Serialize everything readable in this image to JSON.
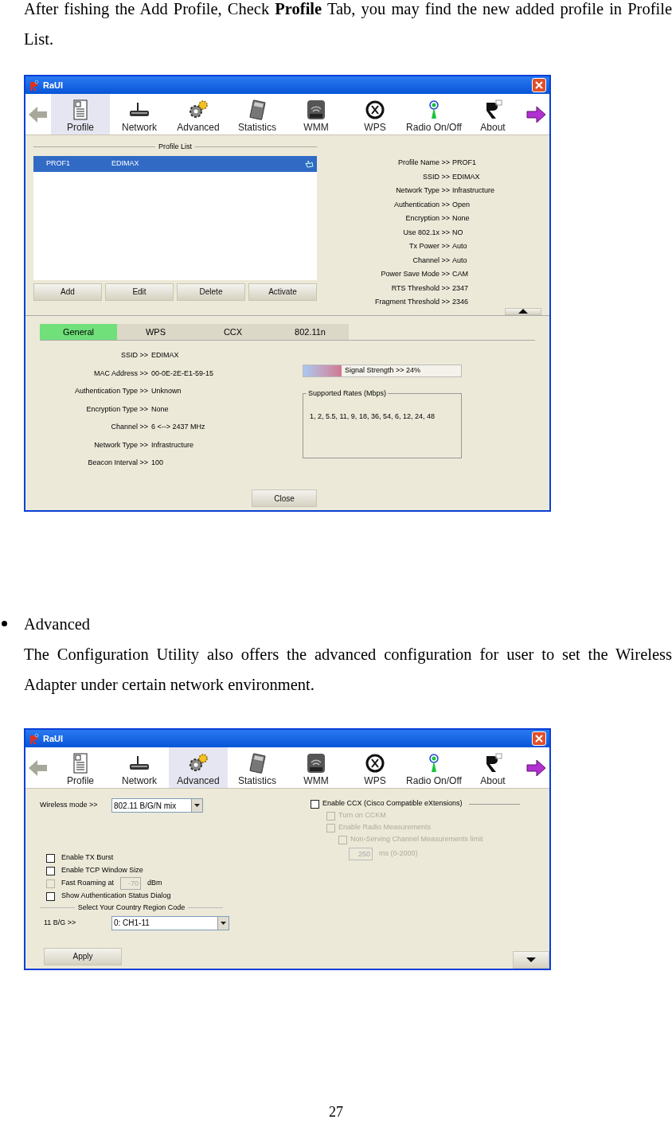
{
  "intro": "After fishing the Add Profile, Check **Profile** Tab, you may find the new added profile in Profile List.",
  "window_profile": {
    "title": "RaUI",
    "toolbar": [
      {
        "label": "Profile",
        "kind": "profile",
        "selected": true
      },
      {
        "label": "Network",
        "kind": "network",
        "selected": false
      },
      {
        "label": "Advanced",
        "kind": "advanced",
        "selected": false
      },
      {
        "label": "Statistics",
        "kind": "statistics",
        "selected": false
      },
      {
        "label": "WMM",
        "kind": "wmm",
        "selected": false
      },
      {
        "label": "WPS",
        "kind": "wps",
        "selected": false
      },
      {
        "label": "Radio On/Off",
        "kind": "radio",
        "selected": false
      },
      {
        "label": "About",
        "kind": "about",
        "selected": false
      }
    ],
    "profile_list": {
      "legend": "Profile List",
      "rows": [
        {
          "name": "PROF1",
          "ssid": "EDIMAX",
          "selected": true
        }
      ],
      "buttons": [
        "Add",
        "Edit",
        "Delete",
        "Activate"
      ]
    },
    "details": [
      {
        "label": "Profile Name >>",
        "value": "PROF1"
      },
      {
        "label": "SSID >>",
        "value": "EDIMAX"
      },
      {
        "label": "Network Type >>",
        "value": "Infrastructure"
      },
      {
        "label": "Authentication >>",
        "value": "Open"
      },
      {
        "label": "Encryption >>",
        "value": "None"
      },
      {
        "label": "Use 802.1x >>",
        "value": "NO"
      },
      {
        "label": "Tx Power >>",
        "value": "Auto"
      },
      {
        "label": "Channel >>",
        "value": "Auto"
      },
      {
        "label": "Power Save Mode >>",
        "value": "CAM"
      },
      {
        "label": "RTS Threshold >>",
        "value": "2347"
      },
      {
        "label": "Fragment Threshold >>",
        "value": "2346"
      }
    ],
    "tabs": [
      {
        "label": "General",
        "selected": true
      },
      {
        "label": "WPS",
        "selected": false
      },
      {
        "label": "CCX",
        "selected": false
      },
      {
        "label": "802.11n",
        "selected": false
      }
    ],
    "general": [
      {
        "label": "SSID >>",
        "value": "EDIMAX"
      },
      {
        "label": "MAC Address >>",
        "value": "00-0E-2E-E1-59-15"
      },
      {
        "label": "Authentication Type >>",
        "value": "Unknown"
      },
      {
        "label": "Encryption Type >>",
        "value": "None"
      },
      {
        "label": "Channel >>",
        "value": "6 <--> 2437 MHz"
      },
      {
        "label": "Network Type >>",
        "value": "Infrastructure"
      },
      {
        "label": "Beacon Interval >>",
        "value": "100"
      }
    ],
    "signal": {
      "label": "Signal Strength >> 24%",
      "level": 0.24
    },
    "supported_rates": {
      "legend": "Supported Rates (Mbps)",
      "value": "1, 2, 5.5, 11, 9, 18, 36, 54, 6, 12, 24, 48"
    },
    "close_button": "Close"
  },
  "bullet": {
    "title": "Advanced",
    "text": "The Configuration Utility also offers the advanced configuration for user to set the Wireless Adapter under certain network environment."
  },
  "window_advanced": {
    "title": "RaUI",
    "toolbar": [
      {
        "label": "Profile",
        "kind": "profile",
        "selected": false
      },
      {
        "label": "Network",
        "kind": "network",
        "selected": false
      },
      {
        "label": "Advanced",
        "kind": "advanced",
        "selected": true
      },
      {
        "label": "Statistics",
        "kind": "statistics",
        "selected": false
      },
      {
        "label": "WMM",
        "kind": "wmm",
        "selected": false
      },
      {
        "label": "WPS",
        "kind": "wps",
        "selected": false
      },
      {
        "label": "Radio On/Off",
        "kind": "radio",
        "selected": false
      },
      {
        "label": "About",
        "kind": "about",
        "selected": false
      }
    ],
    "wireless_mode": {
      "label": "Wireless mode >>",
      "value": "802.11 B/G/N mix"
    },
    "options": [
      {
        "label": "Enable TX Burst",
        "checked": false
      },
      {
        "label": "Enable TCP Window Size",
        "checked": false
      },
      {
        "label": "Fast Roaming at",
        "checked": false,
        "disabled": true,
        "value": "-70",
        "unit": "dBm"
      },
      {
        "label": "Show Authentication Status Dialog",
        "checked": false
      }
    ],
    "country": {
      "legend": "Select Your Country Region Code",
      "label": "11 B/G >>",
      "value": "0: CH1-11"
    },
    "apply_button": "Apply",
    "ccx": {
      "label": "Enable CCX (Cisco Compatible eXtensions)",
      "checked": false,
      "children": [
        {
          "label": "Turn on CCKM",
          "checked": false,
          "disabled": true
        },
        {
          "label": "Enable Radio Measurements",
          "checked": false,
          "disabled": true,
          "children": [
            {
              "label": "Non-Serving Channel Measurements limit",
              "checked": false,
              "disabled": true
            }
          ]
        }
      ],
      "limit": {
        "value": "250",
        "unit": "ms (0-2000)",
        "disabled": true
      }
    }
  },
  "page_number": "27"
}
